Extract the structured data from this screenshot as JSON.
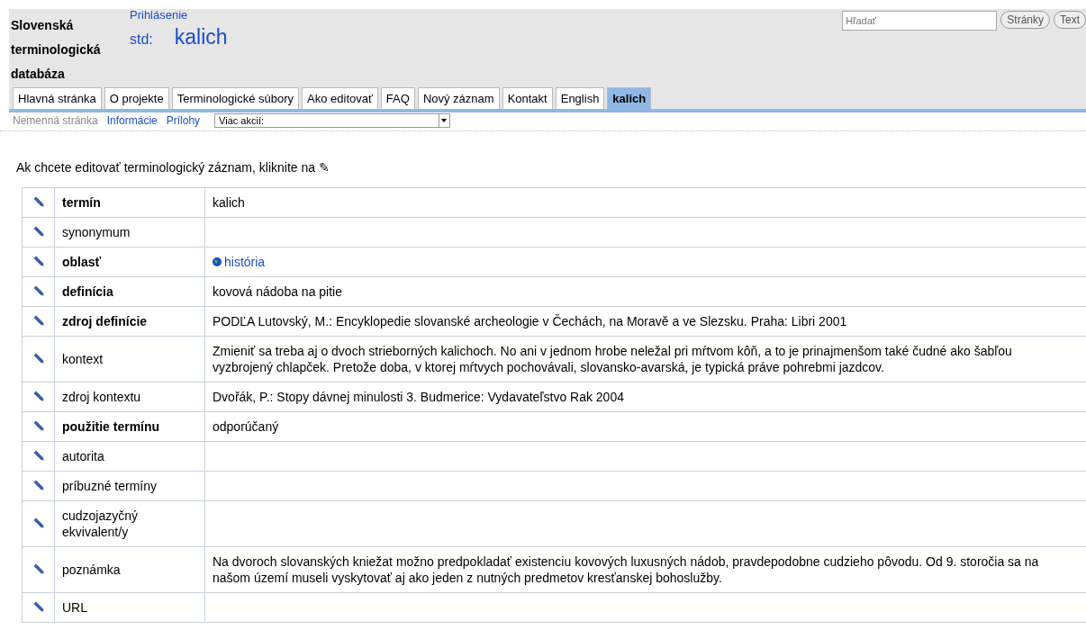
{
  "site_title": "Slovenská terminologická databáza",
  "login_link": "Prihlásenie",
  "page": {
    "prefix": "std:",
    "title": "kalich"
  },
  "search": {
    "placeholder": "Hľadať",
    "buttons": [
      "Stránky",
      "Text"
    ]
  },
  "tabs": [
    {
      "label": "Hlavná stránka",
      "selected": false
    },
    {
      "label": "O projekte",
      "selected": false
    },
    {
      "label": "Terminologické súbory",
      "selected": false
    },
    {
      "label": "Ako editovať",
      "selected": false
    },
    {
      "label": "FAQ",
      "selected": false
    },
    {
      "label": "Nový záznam",
      "selected": false
    },
    {
      "label": "Kontakt",
      "selected": false
    },
    {
      "label": "English",
      "selected": false
    },
    {
      "label": "kalich",
      "selected": true
    }
  ],
  "actions": {
    "disabled_item": "Nemenná stránka",
    "links": [
      "Informácie",
      "Prílohy"
    ],
    "select": "Viac akcií:"
  },
  "instruction": "Ak chcete editovať terminologický záznam, kliknite na ✎",
  "rows": [
    {
      "label": "termín",
      "bold": true,
      "value": "kalich"
    },
    {
      "label": "synonymum",
      "bold": false
    },
    {
      "label": "oblasť",
      "bold": true,
      "value": "história",
      "kind": "link"
    },
    {
      "label": "definícia",
      "bold": true,
      "value": "kovová nádoba na pitie"
    },
    {
      "label": "zdroj definície",
      "bold": true,
      "value": "PODĽA Lutovský, M.: Encyklopedie slovanské archeologie v Čechách, na Moravě a ve Slezsku. Praha: Libri 2001"
    },
    {
      "label": "kontext",
      "bold": false,
      "value": "Zmieniť sa treba aj o dvoch strieborných kalichoch. No ani v jednom hrobe neležal pri mŕtvom kôň, a to je prinajmenšom také čudné ako šabľou vyzbrojený chlapček. Pretože doba, v ktorej mŕtvych pochovávali, slovansko-avarská, je typická práve pohrebmi jazdcov."
    },
    {
      "label": "zdroj kontextu",
      "bold": false,
      "value": "Dvořák, P.: Stopy dávnej minulosti 3. Budmerice: Vydavateľstvo Rak 2004"
    },
    {
      "label": "použitie termínu",
      "bold": true,
      "value": "odporúčaný"
    },
    {
      "label": "autorita",
      "bold": false
    },
    {
      "label": "príbuzné termíny",
      "bold": false
    },
    {
      "label": "cudzojazyčný ekvivalent/y",
      "bold": false
    },
    {
      "label": "poznámka",
      "bold": false,
      "value": "Na dvoroch slovanských kniežat možno predpokladať existenciu kovových luxusných nádob, pravdepodobne cudzieho pôvodu. Od 9. storočia sa na našom území museli vyskytovať aj ako jeden z nutných predmetov kresťanskej bohoslužby."
    },
    {
      "label": "URL",
      "bold": false
    }
  ]
}
